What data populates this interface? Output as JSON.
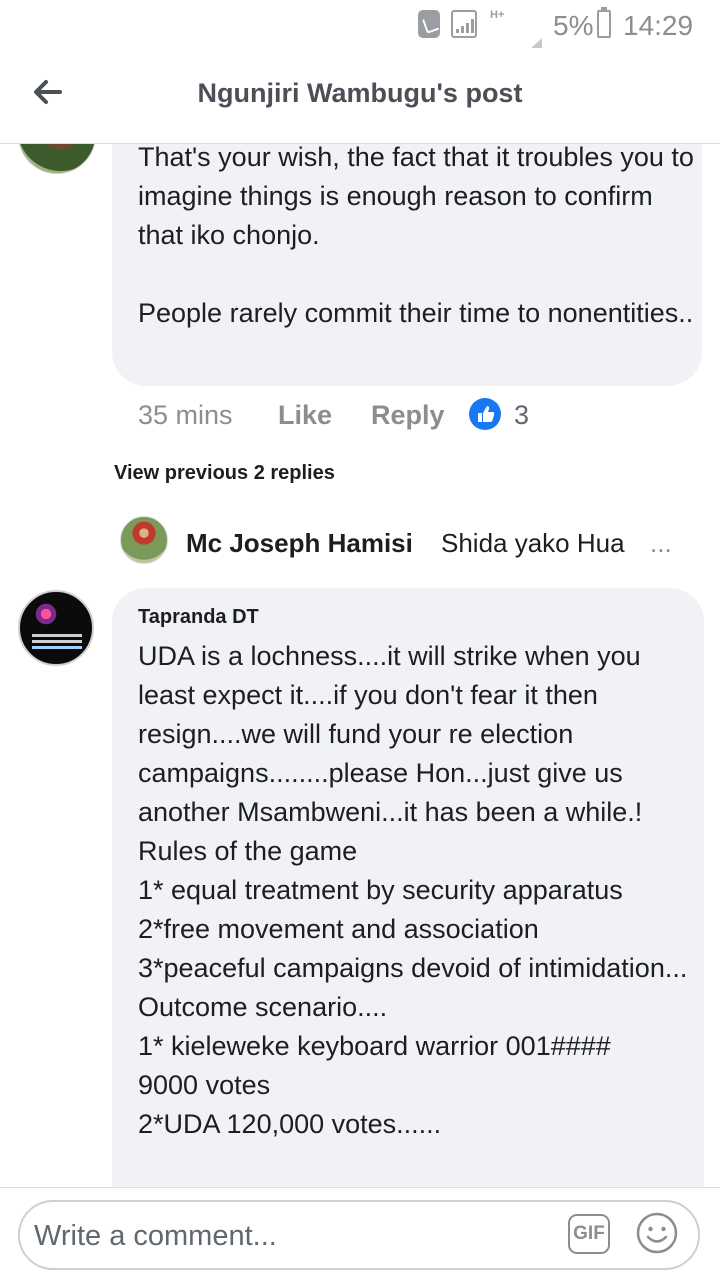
{
  "status_bar": {
    "hplus": "H+",
    "battery_percent": "5%",
    "time": "14:29"
  },
  "header": {
    "title": "Ngunjiri Wambugu's post",
    "back_icon": "arrow-left-icon"
  },
  "comments": [
    {
      "text": "That's your wish, the fact that it troubles you to imagine things is enough reason to confirm that iko chonjo.\n\nPeople rarely commit their time to nonentities..",
      "time": "35 mins",
      "like_label": "Like",
      "reply_label": "Reply",
      "reaction_icon": "thumbs-up-icon",
      "reaction_count": "3"
    }
  ],
  "view_previous": "View previous 2 replies",
  "reply_preview": {
    "name": "Mc Joseph Hamisi",
    "snippet": "Shida yako Hua",
    "ellipsis": "..."
  },
  "main_comment": {
    "author": "Tapranda DT",
    "text": "UDA is a lochness....it will strike when you least expect it....if you don't fear it then resign....we will fund your re election campaigns........please Hon...just give us another Msambweni...it has been a while.!\nRules of the game\n1* equal treatment by security apparatus\n2*free movement and association\n3*peaceful campaigns devoid of intimidation...\nOutcome scenario....\n1* kieleweke keyboard warrior 001####\n9000 votes\n2*UDA 120,000 votes......"
  },
  "composer": {
    "placeholder": "Write a comment...",
    "gif_label": "GIF",
    "emoji_icon": "smiley-icon"
  },
  "colors": {
    "accent": "#1877f2",
    "bubble": "#f0f2f5",
    "muted": "#8a8d91"
  }
}
